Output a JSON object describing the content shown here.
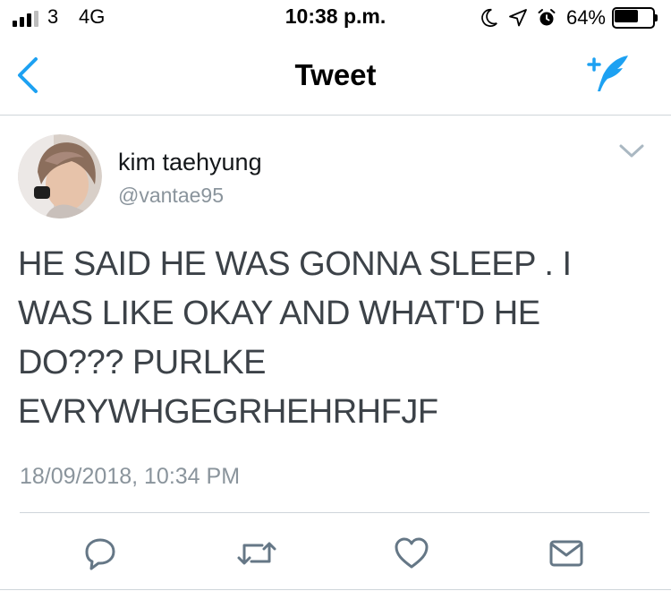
{
  "status_bar": {
    "carrier": "3",
    "network": "4G",
    "time": "10:38 p.m.",
    "battery_percent": "64%",
    "battery_level": 0.64,
    "signal_bars": 3
  },
  "nav": {
    "title": "Tweet",
    "back_icon": "chevron-left-icon",
    "compose_icon": "compose-feather-icon",
    "accent_color": "#1da1f2"
  },
  "tweet": {
    "author_name": "kim taehyung",
    "author_handle": "@vantae95",
    "text": "HE SAID HE WAS GONNA SLEEP . I WAS LIKE OKAY AND WHAT'D HE DO??? PURLKE EVRYWHGEGRHEHRHFJF",
    "timestamp": "18/09/2018, 10:34 PM"
  },
  "actions": [
    {
      "icon": "reply-icon"
    },
    {
      "icon": "retweet-icon"
    },
    {
      "icon": "like-icon"
    },
    {
      "icon": "message-icon"
    }
  ]
}
